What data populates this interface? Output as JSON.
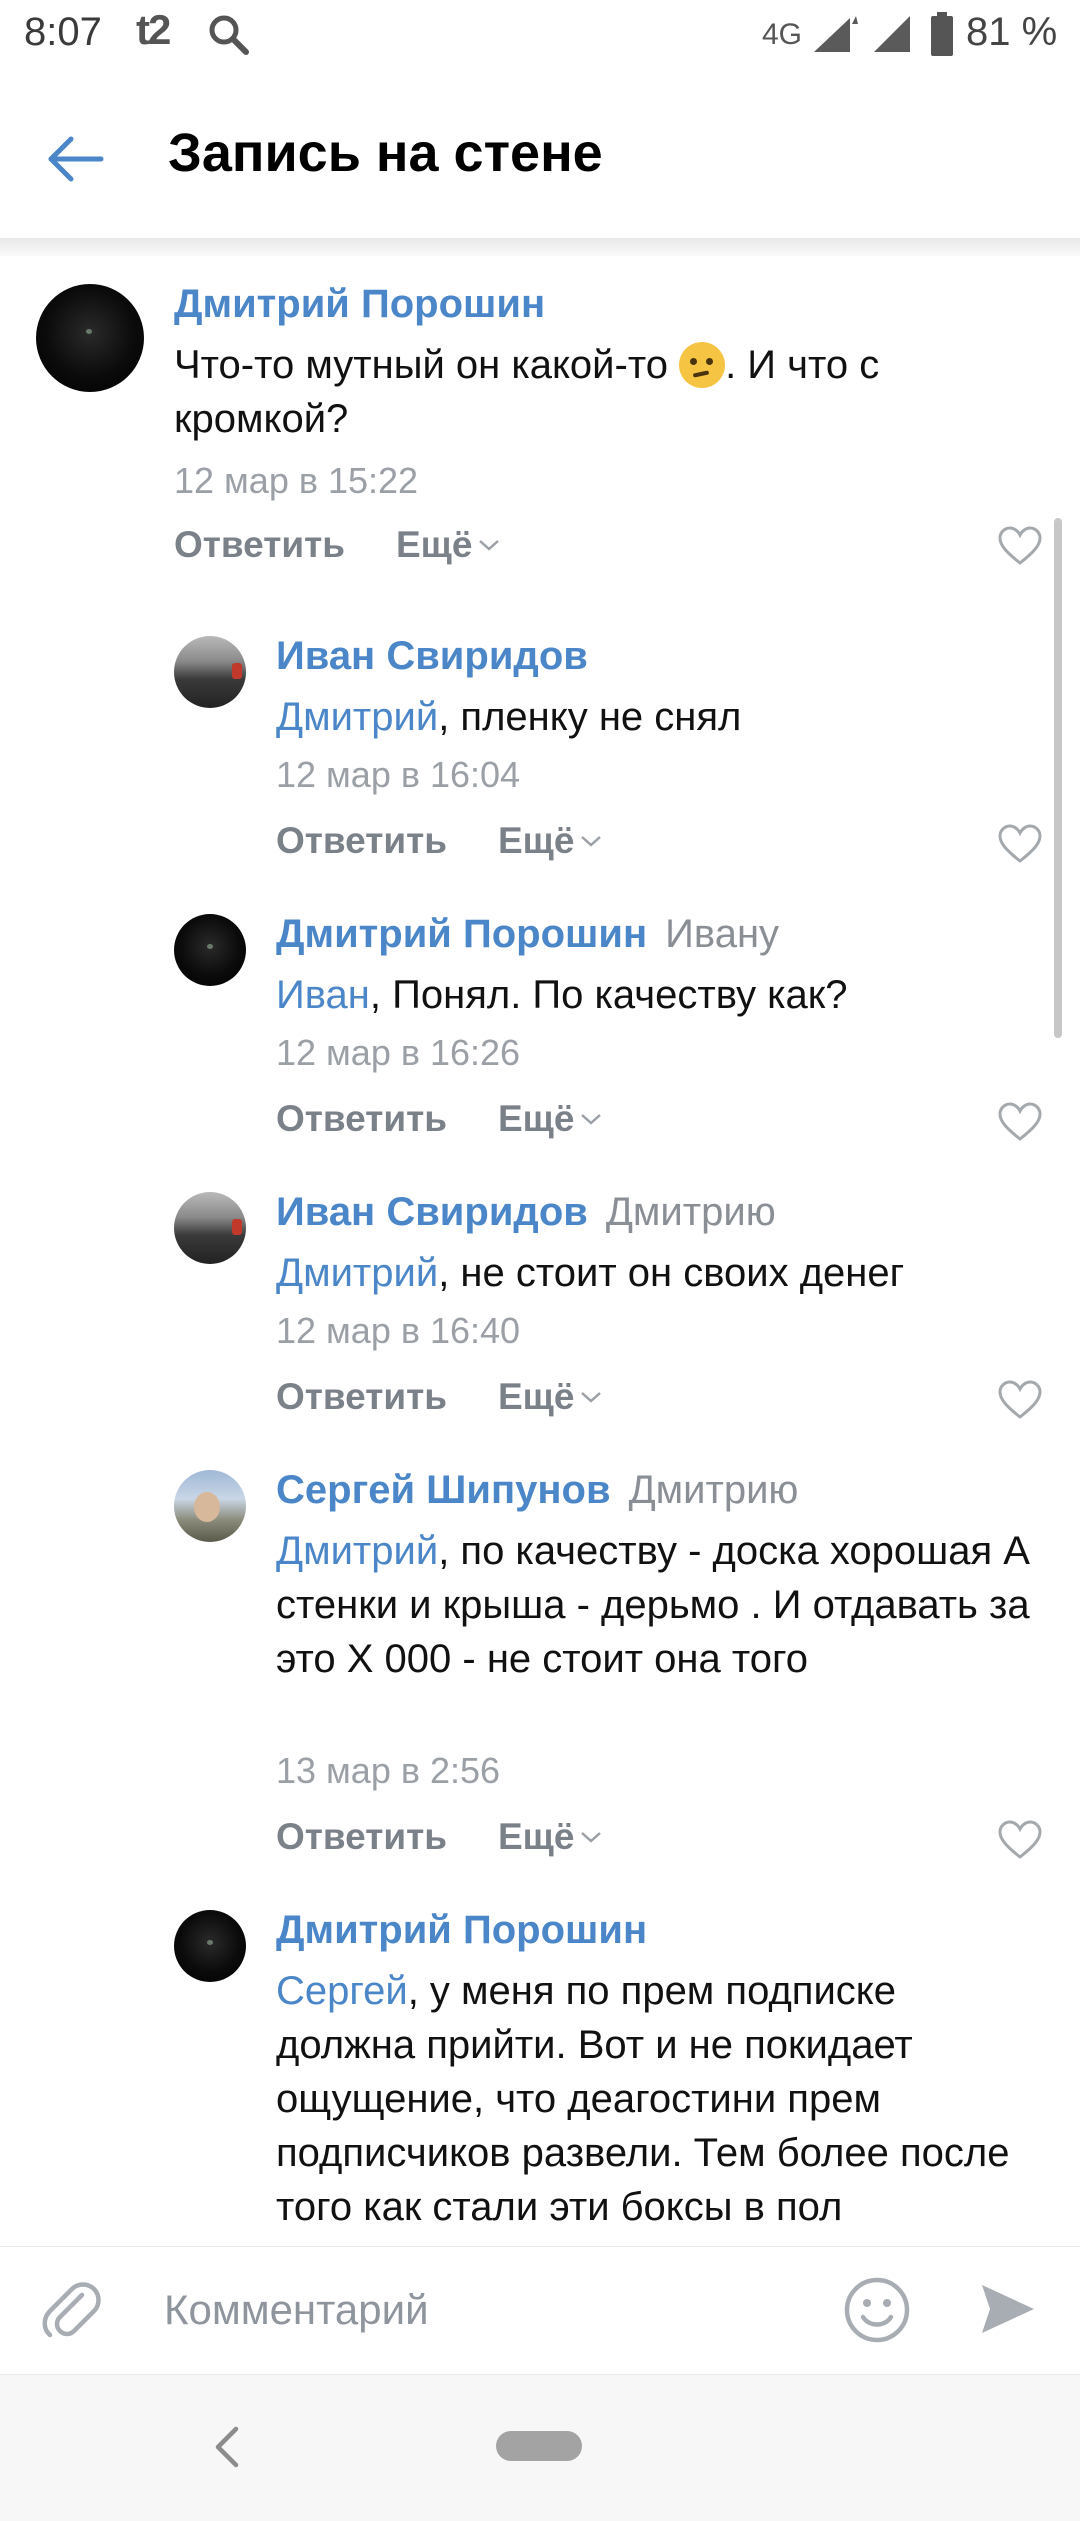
{
  "status_bar": {
    "time": "8:07",
    "carrier": "t2",
    "network": "4G",
    "battery": "81 %"
  },
  "header": {
    "title": "Запись на стене"
  },
  "comments": [
    {
      "author": "Дмитрий Порошин",
      "reply_to": "",
      "mention": "",
      "text_before_emoji": "Что-то мутный он какой-то",
      "text_after_emoji": ". И что с кромкой?",
      "date": "12 мар в 15:22",
      "reply_label": "Ответить",
      "more_label": "Ещё"
    },
    {
      "author": "Иван Свиридов",
      "reply_to": "",
      "mention": "Дмитрий",
      "text": ", пленку не снял",
      "date": "12 мар в 16:04",
      "reply_label": "Ответить",
      "more_label": "Ещё"
    },
    {
      "author": "Дмитрий Порошин",
      "reply_to": "Ивану",
      "mention": "Иван",
      "text": ", Понял. По качеству как?",
      "date": "12 мар в 16:26",
      "reply_label": "Ответить",
      "more_label": "Ещё"
    },
    {
      "author": "Иван Свиридов",
      "reply_to": "Дмитрию",
      "mention": "Дмитрий",
      "text": ", не стоит он своих денег",
      "date": "12 мар в 16:40",
      "reply_label": "Ответить",
      "more_label": "Ещё"
    },
    {
      "author": "Сергей Шипунов",
      "reply_to": "Дмитрию",
      "mention": "Дмитрий",
      "text": ", по качеству - доска хорошая А стенки и крыша - дерьмо . И отдавать за это Х 000 - не стоит она того",
      "date": "13 мар в 2:56",
      "reply_label": "Ответить",
      "more_label": "Ещё"
    },
    {
      "author": "Дмитрий Порошин",
      "reply_to": "",
      "mention": "Сергей",
      "text": ", у меня по прем подписке должна прийти. Вот и не покидает ощущение, что деагостини прем подписчиков развели. Тем более после того как стали эти боксы в пол"
    }
  ],
  "input": {
    "placeholder": "Комментарий"
  },
  "colors": {
    "link": "#4a86c8",
    "secondary": "#9aa0a6",
    "action": "#7b8189"
  }
}
